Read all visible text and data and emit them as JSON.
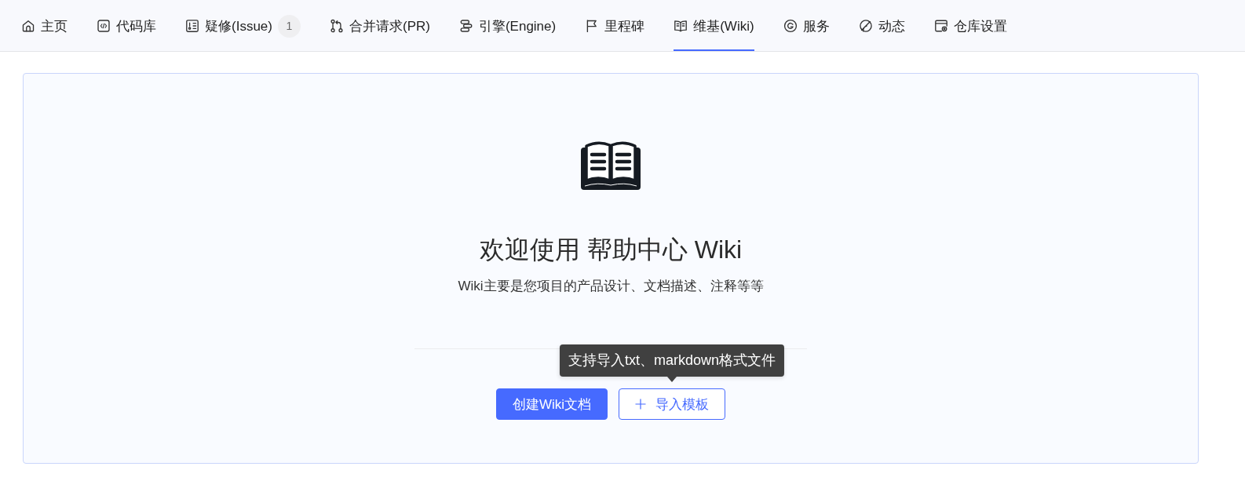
{
  "nav": {
    "tabs": [
      {
        "label": "主页",
        "selected": false
      },
      {
        "label": "代码库",
        "selected": false
      },
      {
        "label": "疑修(Issue)",
        "badge": "1",
        "selected": false
      },
      {
        "label": "合并请求(PR)",
        "selected": false
      },
      {
        "label": "引擎(Engine)",
        "selected": false
      },
      {
        "label": "里程碑",
        "selected": false
      },
      {
        "label": "维基(Wiki)",
        "selected": true
      },
      {
        "label": "服务",
        "selected": false
      },
      {
        "label": "动态",
        "selected": false
      },
      {
        "label": "仓库设置",
        "selected": false
      }
    ]
  },
  "wiki": {
    "title": "欢迎使用 帮助中心 Wiki",
    "subtitle": "Wiki主要是您项目的产品设计、文档描述、注释等等",
    "buttons": [
      {
        "label": "创建Wiki文档",
        "kind": "primary"
      },
      {
        "label": "导入模板",
        "kind": "outline",
        "tooltip": "支持导入txt、markdown格式文件"
      }
    ]
  }
}
